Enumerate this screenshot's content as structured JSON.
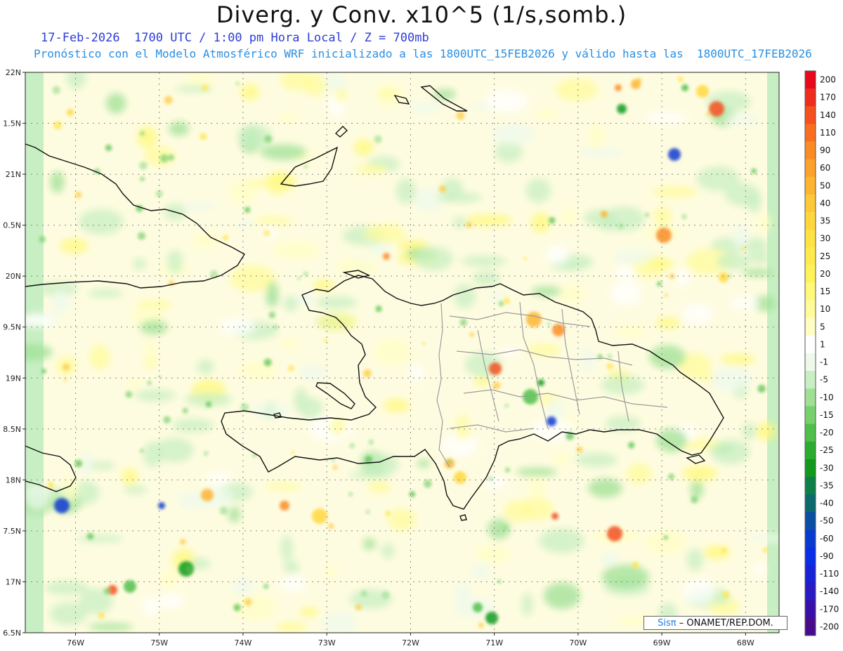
{
  "header": {
    "title": "Diverg. y Conv. x10^5 (1/s,somb.)",
    "subtitle_time": "17-Feb-2026  1700 UTC / 1:00 pm Hora Local / Z = 700mb",
    "subtitle_model": "Pronóstico con el Modelo Atmosférico WRF inicializado a las 1800UTC_15FEB2026 y válido hasta las  1800UTC_17FEB2026"
  },
  "map": {
    "lat_range": [
      16.5,
      22.0
    ],
    "lon_range": [
      -76.6,
      -67.6
    ],
    "lat_ticks": [
      {
        "lat": 22.0,
        "label": "22N"
      },
      {
        "lat": 21.5,
        "label": "1.5N"
      },
      {
        "lat": 21.0,
        "label": "21N"
      },
      {
        "lat": 20.5,
        "label": "0.5N"
      },
      {
        "lat": 20.0,
        "label": "20N"
      },
      {
        "lat": 19.5,
        "label": "9.5N"
      },
      {
        "lat": 19.0,
        "label": "19N"
      },
      {
        "lat": 18.5,
        "label": "8.5N"
      },
      {
        "lat": 18.0,
        "label": "18N"
      },
      {
        "lat": 17.5,
        "label": "7.5N"
      },
      {
        "lat": 17.0,
        "label": "17N"
      },
      {
        "lat": 16.5,
        "label": "6.5N"
      }
    ],
    "lon_ticks": [
      {
        "lon": -76,
        "label": "76W"
      },
      {
        "lon": -75,
        "label": "75W"
      },
      {
        "lon": -74,
        "label": "74W"
      },
      {
        "lon": -73,
        "label": "73W"
      },
      {
        "lon": -72,
        "label": "72W"
      },
      {
        "lon": -71,
        "label": "71W"
      },
      {
        "lon": -70,
        "label": "70W"
      },
      {
        "lon": -69,
        "label": "69W"
      },
      {
        "lon": -68,
        "label": "68W"
      }
    ]
  },
  "colorbar": {
    "levels": [
      {
        "label": "200",
        "color": "#e8091c"
      },
      {
        "label": "170",
        "color": "#f02c1c"
      },
      {
        "label": "140",
        "color": "#f5501e"
      },
      {
        "label": "110",
        "color": "#f86f22"
      },
      {
        "label": "90",
        "color": "#fa8c26"
      },
      {
        "label": "60",
        "color": "#fca12b"
      },
      {
        "label": "50",
        "color": "#fdb431"
      },
      {
        "label": "40",
        "color": "#fec838"
      },
      {
        "label": "35",
        "color": "#ffd73d"
      },
      {
        "label": "30",
        "color": "#ffe244"
      },
      {
        "label": "25",
        "color": "#ffeb4d"
      },
      {
        "label": "20",
        "color": "#fff35c"
      },
      {
        "label": "15",
        "color": "#fff87a"
      },
      {
        "label": "10",
        "color": "#fffb9b"
      },
      {
        "label": "5",
        "color": "#fffdc4"
      },
      {
        "label": "1",
        "color": "#ffffff"
      },
      {
        "label": "-1",
        "color": "#eef9ec"
      },
      {
        "label": "-5",
        "color": "#c8efc3"
      },
      {
        "label": "-10",
        "color": "#9fe096"
      },
      {
        "label": "-15",
        "color": "#77d06c"
      },
      {
        "label": "-20",
        "color": "#4fbf4a"
      },
      {
        "label": "-25",
        "color": "#2aad2f"
      },
      {
        "label": "-30",
        "color": "#119a1e"
      },
      {
        "label": "-35",
        "color": "#0e7f48"
      },
      {
        "label": "-40",
        "color": "#0c6a6f"
      },
      {
        "label": "-50",
        "color": "#0a4fa3"
      },
      {
        "label": "-60",
        "color": "#0a3bd0"
      },
      {
        "label": "-90",
        "color": "#0a2ee6"
      },
      {
        "label": "-110",
        "color": "#1a22d8"
      },
      {
        "label": "-140",
        "color": "#2a1ac4"
      },
      {
        "label": "-170",
        "color": "#3810a8"
      },
      {
        "label": "-200",
        "color": "#480b8e"
      }
    ]
  },
  "credit": {
    "brand": "Sisπ",
    "text": "– ONAMET/REP.DOM."
  }
}
